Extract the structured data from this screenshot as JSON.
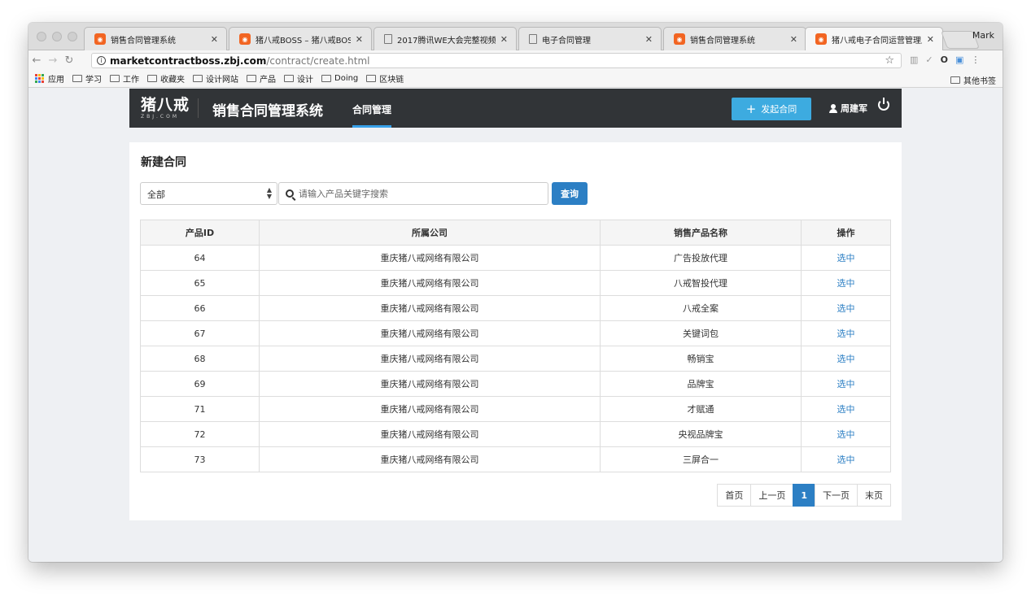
{
  "browser": {
    "tabs": [
      {
        "title": "销售合同管理系统",
        "icon": "zbj-favicon"
      },
      {
        "title": "猪八戒BOSS – 猪八戒BOSS",
        "icon": "zbj-favicon"
      },
      {
        "title": "2017腾讯WE大会完整视频 |",
        "icon": "document-icon"
      },
      {
        "title": "电子合同管理",
        "icon": "document-icon"
      },
      {
        "title": "销售合同管理系统",
        "icon": "zbj-favicon"
      },
      {
        "title": "猪八戒电子合同运营管理后台",
        "icon": "zbj-favicon"
      }
    ],
    "profile_name": "Mark",
    "url_host": "marketcontractboss.zbj.com",
    "url_path": "/contract/create.html",
    "bookmarks": [
      "应用",
      "学习",
      "工作",
      "收藏夹",
      "设计网站",
      "产品",
      "设计",
      "Doing",
      "区块链"
    ],
    "other_bookmarks": "其他书签"
  },
  "header": {
    "logo_text": "猪八戒",
    "logo_subtext": "ZBJ.COM",
    "system_title": "销售合同管理系统",
    "nav_item": "合同管理",
    "launch_button": "发起合同",
    "user_name": "周建军"
  },
  "main": {
    "title": "新建合同",
    "filter_selected": "全部",
    "search_placeholder": "请输入产品关键字搜索",
    "query_button": "查询",
    "columns": [
      "产品ID",
      "所属公司",
      "销售产品名称",
      "操作"
    ],
    "rows": [
      {
        "id": "64",
        "company": "重庆猪八戒网络有限公司",
        "product": "广告投放代理",
        "action": "选中"
      },
      {
        "id": "65",
        "company": "重庆猪八戒网络有限公司",
        "product": "八戒智投代理",
        "action": "选中"
      },
      {
        "id": "66",
        "company": "重庆猪八戒网络有限公司",
        "product": "八戒全案",
        "action": "选中"
      },
      {
        "id": "67",
        "company": "重庆猪八戒网络有限公司",
        "product": "关键词包",
        "action": "选中"
      },
      {
        "id": "68",
        "company": "重庆猪八戒网络有限公司",
        "product": "畅销宝",
        "action": "选中"
      },
      {
        "id": "69",
        "company": "重庆猪八戒网络有限公司",
        "product": "品牌宝",
        "action": "选中"
      },
      {
        "id": "71",
        "company": "重庆猪八戒网络有限公司",
        "product": "才赋通",
        "action": "选中"
      },
      {
        "id": "72",
        "company": "重庆猪八戒网络有限公司",
        "product": "央视品牌宝",
        "action": "选中"
      },
      {
        "id": "73",
        "company": "重庆猪八戒网络有限公司",
        "product": "三屏合一",
        "action": "选中"
      }
    ],
    "pagination": {
      "first": "首页",
      "prev": "上一页",
      "current": "1",
      "next": "下一页",
      "last": "末页"
    }
  },
  "colors": {
    "navbar_bg": "#313437",
    "accent_blue": "#2c7fc4",
    "launch_button": "#3dabe0",
    "favicon_orange": "#f26522"
  }
}
